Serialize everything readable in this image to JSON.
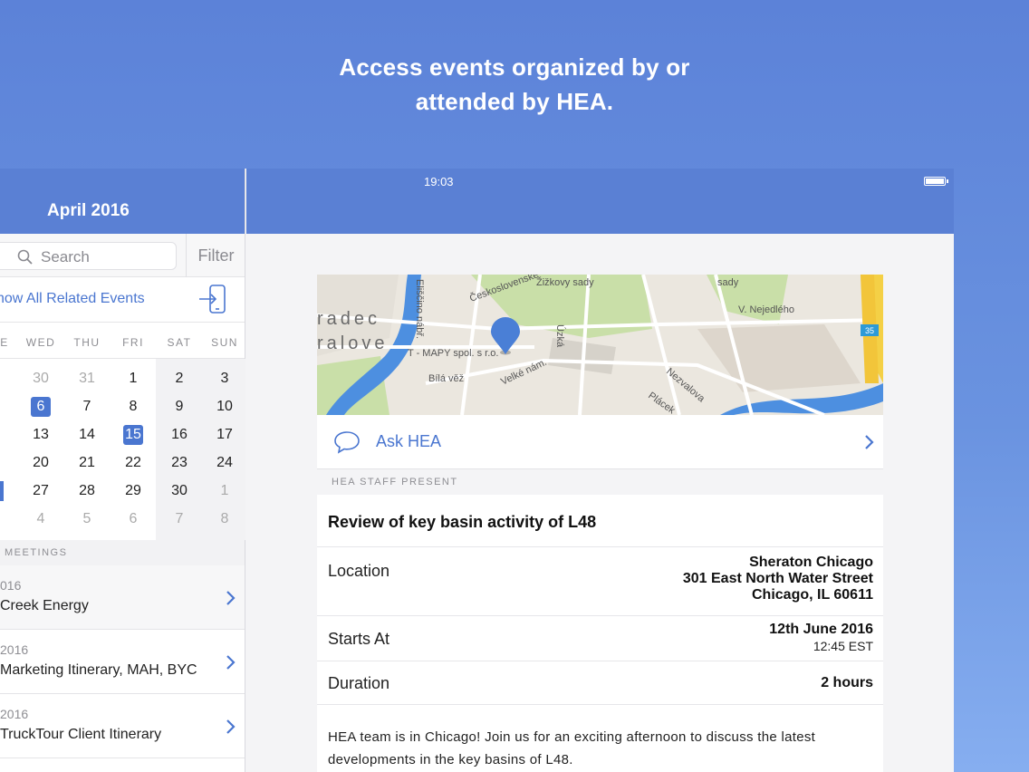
{
  "headline": {
    "line1": "Access events organized by or",
    "line2": "attended by HEA."
  },
  "left": {
    "month_title": "April 2016",
    "search": {
      "placeholder": "Search",
      "icon": "search-icon"
    },
    "filter_label": "Filter",
    "related_link": "how All Related Events",
    "weekdays": [
      "E",
      "WED",
      "THU",
      "FRI",
      "SAT",
      "SUN"
    ],
    "weeks": [
      [
        {
          "d": "30",
          "dim": true
        },
        {
          "d": "31",
          "dim": true
        },
        {
          "d": "1"
        },
        {
          "d": "2"
        },
        {
          "d": "3"
        }
      ],
      [
        {
          "d": "6",
          "sel": true
        },
        {
          "d": "7"
        },
        {
          "d": "8"
        },
        {
          "d": "9"
        },
        {
          "d": "10"
        }
      ],
      [
        {
          "d": "13"
        },
        {
          "d": "14"
        },
        {
          "d": "15",
          "sel": true
        },
        {
          "d": "16"
        },
        {
          "d": "17"
        }
      ],
      [
        {
          "d": "20"
        },
        {
          "d": "21"
        },
        {
          "d": "22"
        },
        {
          "d": "23"
        },
        {
          "d": "24"
        }
      ],
      [
        {
          "d": "27"
        },
        {
          "d": "28"
        },
        {
          "d": "29"
        },
        {
          "d": "30"
        },
        {
          "d": "1",
          "dim": true
        }
      ],
      [
        {
          "d": "4",
          "dim": true
        },
        {
          "d": "5",
          "dim": true
        },
        {
          "d": "6",
          "dim": true
        },
        {
          "d": "7",
          "dim": true
        },
        {
          "d": "8",
          "dim": true
        }
      ]
    ],
    "meetings_header": "MEETINGS",
    "meetings": [
      {
        "date": "016",
        "title": "Creek Energy"
      },
      {
        "date": "2016",
        "title": "Marketing Itinerary, MAH, BYC"
      },
      {
        "date": "2016",
        "title": "TruckTour Client Itinerary"
      }
    ]
  },
  "status": {
    "time": "19:03"
  },
  "map": {
    "labels": [
      "Žižkovy sady",
      "sady",
      "V. Nejedlého",
      "Československé",
      "radec",
      "ralove",
      "T - MAPY spol. s r.o.",
      "Bílá věž",
      "Velké nám.",
      "Nezvalova",
      "Plácek",
      "Eliščino nábř.",
      "Úzká",
      "35"
    ]
  },
  "ask": {
    "label": "Ask HEA",
    "icon": "chat-bubble-icon"
  },
  "staff_header": "HEA STAFF PRESENT",
  "event": {
    "title": "Review of key basin activity of L48",
    "location_label": "Location",
    "location_lines": [
      "Sheraton Chicago",
      "301 East North Water Street",
      "Chicago, IL 60611"
    ],
    "starts_label": "Starts At",
    "starts_date": "12th June 2016",
    "starts_time": "12:45 EST",
    "duration_label": "Duration",
    "duration_value": "2 hours",
    "description": "HEA team is in Chicago! Join us for an exciting afternoon to discuss the latest developments in the key basins of L48."
  },
  "colors": {
    "accent": "#4a76d0",
    "nav": "#5a80d4"
  }
}
